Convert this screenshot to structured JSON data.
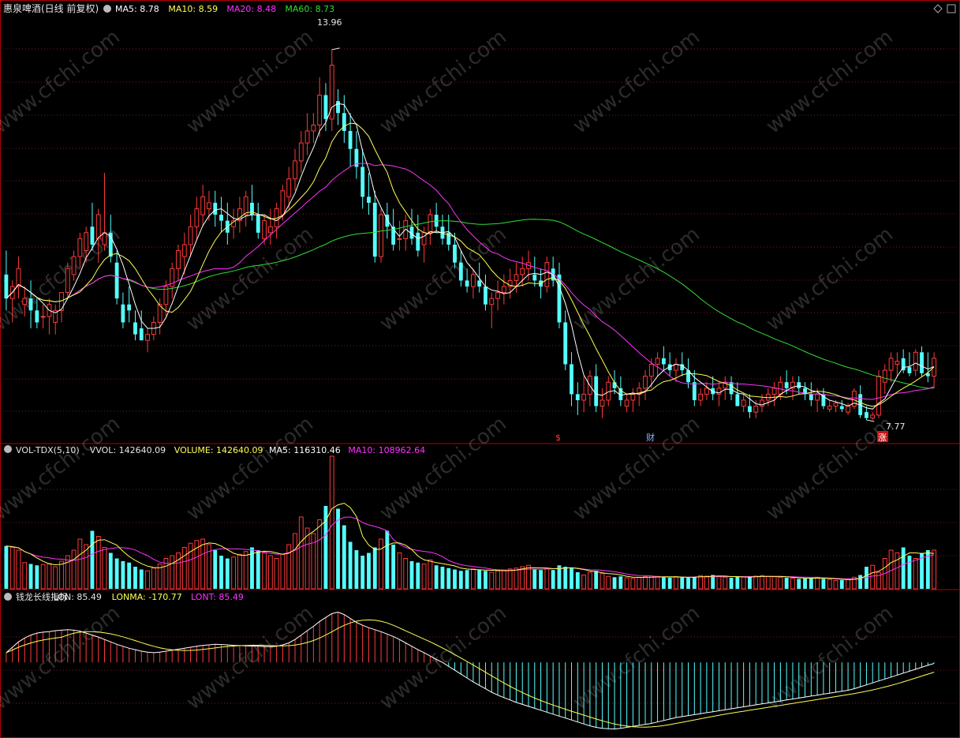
{
  "colors": {
    "background": "#000000",
    "frame": "#b00000",
    "grid": "#7a1a1a",
    "up": "#ff3a3a",
    "down": "#54ffff",
    "text": "#e6e6e6",
    "ma5": "#ffffff",
    "ma10": "#ffff55",
    "ma20": "#ff33ff",
    "ma60": "#33dd33",
    "watermark": "#ffffff"
  },
  "price_panel": {
    "title": "惠泉啤酒(日线 前复权)",
    "legend": [
      {
        "label": "MA5: 8.78",
        "color": "#ffffff"
      },
      {
        "label": "MA10: 8.59",
        "color": "#ffff55"
      },
      {
        "label": "MA20: 8.48",
        "color": "#ff33ff"
      },
      {
        "label": "MA60: 8.73",
        "color": "#33dd33"
      }
    ],
    "high_label": "13.96",
    "low_label": "7.77",
    "event_markers": [
      {
        "text": "$",
        "color": "#ff3a3a"
      },
      {
        "text": "财",
        "color": "#8ab4ff"
      },
      {
        "text": "涨",
        "color": "#ffffff"
      }
    ]
  },
  "volume_panel": {
    "legend": [
      {
        "label": "VOL-TDX(5,10)",
        "color": "#e6e6e6"
      },
      {
        "label": "VVOL: 142640.09",
        "color": "#e6e6e6"
      },
      {
        "label": "VOLUME: 142640.09",
        "color": "#ffff55"
      },
      {
        "label": "MA5: 116310.46",
        "color": "#ffffff"
      },
      {
        "label": "MA10: 108962.64",
        "color": "#ff33ff"
      }
    ]
  },
  "indicator_panel": {
    "legend": [
      {
        "label": "钱龙长线指标",
        "color": "#e6e6e6"
      },
      {
        "label": "LON: 85.49",
        "color": "#e6e6e6"
      },
      {
        "label": "LONMA: -170.77",
        "color": "#ffff55"
      },
      {
        "label": "LONT: 85.49",
        "color": "#ff33ff"
      }
    ]
  },
  "watermark_text": "www.cfchi.com",
  "chart_data": [
    {
      "type": "candlestick",
      "title": "惠泉啤酒(日线 前复权)",
      "series": [
        {
          "name": "MA5",
          "last": 8.78
        },
        {
          "name": "MA10",
          "last": 8.59
        },
        {
          "name": "MA20",
          "last": 8.48
        },
        {
          "name": "MA60",
          "last": 8.73
        }
      ],
      "ylim": [
        7.4,
        14.5
      ],
      "labeled_extremes": {
        "high": 13.96,
        "low": 7.77
      },
      "ohlc": [
        [
          10.2,
          10.6,
          9.6,
          9.8
        ],
        [
          9.8,
          10.1,
          9.4,
          10.0
        ],
        [
          10.0,
          10.5,
          9.8,
          10.3
        ],
        [
          9.7,
          10.0,
          9.5,
          9.8
        ],
        [
          9.8,
          10.1,
          9.3,
          9.6
        ],
        [
          9.6,
          9.8,
          9.3,
          9.4
        ],
        [
          9.5,
          9.7,
          9.3,
          9.5
        ],
        [
          9.5,
          9.8,
          9.2,
          9.7
        ],
        [
          9.4,
          9.7,
          9.2,
          9.6
        ],
        [
          9.6,
          9.9,
          9.4,
          9.9
        ],
        [
          9.9,
          10.4,
          9.8,
          10.3
        ],
        [
          10.2,
          10.6,
          10.1,
          10.5
        ],
        [
          10.5,
          10.9,
          10.3,
          10.8
        ],
        [
          10.6,
          11.0,
          10.4,
          10.9
        ],
        [
          11.0,
          11.4,
          10.6,
          10.7
        ],
        [
          10.8,
          11.3,
          10.4,
          11.2
        ],
        [
          10.7,
          11.9,
          10.6,
          10.9
        ],
        [
          10.9,
          11.2,
          10.4,
          10.5
        ],
        [
          10.4,
          10.6,
          9.7,
          9.8
        ],
        [
          9.7,
          9.9,
          9.3,
          9.4
        ],
        [
          9.7,
          10.0,
          9.4,
          9.6
        ],
        [
          9.4,
          9.6,
          9.1,
          9.2
        ],
        [
          9.3,
          9.6,
          9.1,
          9.1
        ],
        [
          9.1,
          9.3,
          8.9,
          9.2
        ],
        [
          9.2,
          9.5,
          9.1,
          9.4
        ],
        [
          9.4,
          9.8,
          9.2,
          9.7
        ],
        [
          9.7,
          10.1,
          9.5,
          10.0
        ],
        [
          10.0,
          10.4,
          9.8,
          10.3
        ],
        [
          10.3,
          10.7,
          10.1,
          10.6
        ],
        [
          10.5,
          10.9,
          10.2,
          10.7
        ],
        [
          10.7,
          11.2,
          10.5,
          11.0
        ],
        [
          11.0,
          11.5,
          10.8,
          11.3
        ],
        [
          11.2,
          11.7,
          11.0,
          11.5
        ],
        [
          11.3,
          11.6,
          11.1,
          11.4
        ],
        [
          11.4,
          11.6,
          11.0,
          11.2
        ],
        [
          11.2,
          11.5,
          10.9,
          11.1
        ],
        [
          11.1,
          11.4,
          10.7,
          10.9
        ],
        [
          11.0,
          11.3,
          10.8,
          11.1
        ],
        [
          11.1,
          11.5,
          10.9,
          11.3
        ],
        [
          11.2,
          11.6,
          11.0,
          11.5
        ],
        [
          11.4,
          11.7,
          11.1,
          11.2
        ],
        [
          11.2,
          11.4,
          10.8,
          10.9
        ],
        [
          10.8,
          11.2,
          10.7,
          11.1
        ],
        [
          10.9,
          11.3,
          10.7,
          11.0
        ],
        [
          11.0,
          11.4,
          10.8,
          11.3
        ],
        [
          11.2,
          11.7,
          11.1,
          11.6
        ],
        [
          11.5,
          12.0,
          11.3,
          11.8
        ],
        [
          11.8,
          12.3,
          11.6,
          12.1
        ],
        [
          12.1,
          12.6,
          11.9,
          12.4
        ],
        [
          12.4,
          12.9,
          12.2,
          12.6
        ],
        [
          12.6,
          12.9,
          12.4,
          12.7
        ],
        [
          12.7,
          13.5,
          12.5,
          13.2
        ],
        [
          13.2,
          13.4,
          12.6,
          12.8
        ],
        [
          12.8,
          13.96,
          12.6,
          13.7
        ],
        [
          13.1,
          13.3,
          12.7,
          12.9
        ],
        [
          12.9,
          13.2,
          12.4,
          12.6
        ],
        [
          12.6,
          12.9,
          12.0,
          12.3
        ],
        [
          12.3,
          12.6,
          11.8,
          12.0
        ],
        [
          12.0,
          12.3,
          11.3,
          11.5
        ],
        [
          11.5,
          11.9,
          11.2,
          11.4
        ],
        [
          11.4,
          11.6,
          10.4,
          10.5
        ],
        [
          10.5,
          11.3,
          10.4,
          11.2
        ],
        [
          11.2,
          11.4,
          10.8,
          11.0
        ],
        [
          11.0,
          11.3,
          10.6,
          10.7
        ],
        [
          10.8,
          11.1,
          10.6,
          10.8
        ],
        [
          10.8,
          11.2,
          10.6,
          11.1
        ],
        [
          11.0,
          11.3,
          10.7,
          10.8
        ],
        [
          10.9,
          11.2,
          10.5,
          10.6
        ],
        [
          10.7,
          11.0,
          10.4,
          10.9
        ],
        [
          10.9,
          11.3,
          10.7,
          11.2
        ],
        [
          11.2,
          11.4,
          10.9,
          11.0
        ],
        [
          11.0,
          11.2,
          10.7,
          10.8
        ],
        [
          10.9,
          11.2,
          10.6,
          10.7
        ],
        [
          10.7,
          10.9,
          10.3,
          10.4
        ],
        [
          10.4,
          10.6,
          10.0,
          10.1
        ],
        [
          10.1,
          10.3,
          9.9,
          10.0
        ],
        [
          10.0,
          10.3,
          9.8,
          10.2
        ],
        [
          10.1,
          10.4,
          9.9,
          10.0
        ],
        [
          10.0,
          10.2,
          9.6,
          9.7
        ],
        [
          9.7,
          9.9,
          9.3,
          9.8
        ],
        [
          9.8,
          10.1,
          9.6,
          9.9
        ],
        [
          9.9,
          10.2,
          9.7,
          10.0
        ],
        [
          10.0,
          10.3,
          9.8,
          10.1
        ],
        [
          10.1,
          10.4,
          9.9,
          10.2
        ],
        [
          10.2,
          10.5,
          10.0,
          10.3
        ],
        [
          10.3,
          10.6,
          10.1,
          10.4
        ],
        [
          10.2,
          10.5,
          10.0,
          10.1
        ],
        [
          10.1,
          10.3,
          9.8,
          10.0
        ],
        [
          10.0,
          10.5,
          9.9,
          10.4
        ],
        [
          10.3,
          10.5,
          10.0,
          10.1
        ],
        [
          10.2,
          10.4,
          9.3,
          9.4
        ],
        [
          9.4,
          9.6,
          8.6,
          8.7
        ],
        [
          8.7,
          8.9,
          8.0,
          8.2
        ],
        [
          8.2,
          8.4,
          7.85,
          8.1
        ],
        [
          8.1,
          8.5,
          7.9,
          8.2
        ],
        [
          8.2,
          8.6,
          8.0,
          8.5
        ],
        [
          8.5,
          8.7,
          7.9,
          8.0
        ],
        [
          8.0,
          8.3,
          7.8,
          8.1
        ],
        [
          8.1,
          8.5,
          8.0,
          8.4
        ],
        [
          8.4,
          8.6,
          8.2,
          8.3
        ],
        [
          8.3,
          8.5,
          8.0,
          8.1
        ],
        [
          8.0,
          8.2,
          7.9,
          8.1
        ],
        [
          8.1,
          8.3,
          7.9,
          8.2
        ],
        [
          8.2,
          8.4,
          8.0,
          8.3
        ],
        [
          8.3,
          8.6,
          8.1,
          8.5
        ],
        [
          8.5,
          8.8,
          8.3,
          8.7
        ],
        [
          8.7,
          8.9,
          8.5,
          8.8
        ],
        [
          8.8,
          9.0,
          8.6,
          8.7
        ],
        [
          8.7,
          8.9,
          8.5,
          8.6
        ],
        [
          8.6,
          8.8,
          8.4,
          8.7
        ],
        [
          8.7,
          8.9,
          8.5,
          8.6
        ],
        [
          8.6,
          8.8,
          8.3,
          8.4
        ],
        [
          8.4,
          8.6,
          8.0,
          8.1
        ],
        [
          8.1,
          8.3,
          8.0,
          8.2
        ],
        [
          8.2,
          8.4,
          8.1,
          8.3
        ],
        [
          8.3,
          8.5,
          8.1,
          8.2
        ],
        [
          8.2,
          8.4,
          8.0,
          8.3
        ],
        [
          8.3,
          8.5,
          8.1,
          8.4
        ],
        [
          8.4,
          8.5,
          8.1,
          8.2
        ],
        [
          8.2,
          8.4,
          8.0,
          8.0
        ],
        [
          8.0,
          8.2,
          7.9,
          8.1
        ],
        [
          8.0,
          8.2,
          7.8,
          7.9
        ],
        [
          7.9,
          8.1,
          7.8,
          8.0
        ],
        [
          8.0,
          8.2,
          7.9,
          8.1
        ],
        [
          8.1,
          8.3,
          8.0,
          8.2
        ],
        [
          8.2,
          8.4,
          8.0,
          8.3
        ],
        [
          8.2,
          8.5,
          8.1,
          8.4
        ],
        [
          8.4,
          8.6,
          8.2,
          8.3
        ],
        [
          8.3,
          8.5,
          8.1,
          8.4
        ],
        [
          8.4,
          8.5,
          8.2,
          8.3
        ],
        [
          8.3,
          8.4,
          8.1,
          8.2
        ],
        [
          8.2,
          8.4,
          8.0,
          8.1
        ],
        [
          8.1,
          8.3,
          7.9,
          8.2
        ],
        [
          8.2,
          8.3,
          7.95,
          8.0
        ],
        [
          7.95,
          8.1,
          7.9,
          8.0
        ],
        [
          8.0,
          8.1,
          7.9,
          8.05
        ],
        [
          8.0,
          8.1,
          7.9,
          7.95
        ],
        [
          7.9,
          8.05,
          7.85,
          8.0
        ],
        [
          8.0,
          8.3,
          7.95,
          8.25
        ],
        [
          8.2,
          8.35,
          7.8,
          7.85
        ],
        [
          7.9,
          8.0,
          7.77,
          7.8
        ],
        [
          7.8,
          7.9,
          7.77,
          7.85
        ],
        [
          7.85,
          8.6,
          7.8,
          8.5
        ],
        [
          8.4,
          8.7,
          8.2,
          8.6
        ],
        [
          8.6,
          8.9,
          8.4,
          8.8
        ],
        [
          8.7,
          8.9,
          8.5,
          8.75
        ],
        [
          8.8,
          8.95,
          8.55,
          8.6
        ],
        [
          8.65,
          8.9,
          8.5,
          8.55
        ],
        [
          8.6,
          8.95,
          8.5,
          8.9
        ],
        [
          8.9,
          9.0,
          8.5,
          8.55
        ],
        [
          8.55,
          8.9,
          8.4,
          8.5
        ],
        [
          8.5,
          8.9,
          8.3,
          8.8
        ]
      ]
    },
    {
      "type": "bar",
      "title": "VOL-TDX(5,10)",
      "series": [
        {
          "name": "VOLUME",
          "last": 142640.09
        },
        {
          "name": "MA5",
          "last": 116310.46
        },
        {
          "name": "MA10",
          "last": 108962.64
        }
      ],
      "ylim": [
        0,
        480000
      ],
      "values": [
        155000,
        150000,
        140000,
        95000,
        90000,
        85000,
        88000,
        92000,
        80000,
        100000,
        120000,
        140000,
        180000,
        160000,
        210000,
        190000,
        150000,
        130000,
        110000,
        100000,
        95000,
        80000,
        70000,
        65000,
        75000,
        90000,
        110000,
        120000,
        130000,
        150000,
        165000,
        175000,
        180000,
        160000,
        140000,
        120000,
        110000,
        115000,
        125000,
        135000,
        150000,
        140000,
        130000,
        120000,
        110000,
        125000,
        160000,
        200000,
        260000,
        220000,
        200000,
        250000,
        300000,
        480000,
        290000,
        230000,
        170000,
        140000,
        120000,
        130000,
        150000,
        180000,
        210000,
        160000,
        130000,
        110000,
        100000,
        95000,
        90000,
        105000,
        85000,
        80000,
        75000,
        70000,
        65000,
        68000,
        72000,
        70000,
        65000,
        60000,
        65000,
        68000,
        72000,
        75000,
        80000,
        85000,
        70000,
        68000,
        74000,
        68000,
        85000,
        80000,
        75000,
        60000,
        50000,
        60000,
        65000,
        55000,
        45000,
        42000,
        45000,
        40000,
        38000,
        42000,
        44000,
        46000,
        45000,
        42000,
        40000,
        44000,
        42000,
        40000,
        44000,
        48000,
        46000,
        50000,
        44000,
        42000,
        40000,
        45000,
        44000,
        42000,
        46000,
        48000,
        45000,
        44000,
        42000,
        40000,
        38000,
        36000,
        38000,
        40000,
        42000,
        36000,
        34000,
        30000,
        32000,
        34000,
        42000,
        50000,
        80000,
        85000,
        60000,
        110000,
        140000,
        130000,
        150000,
        120000,
        110000,
        130000,
        140000,
        140000
      ]
    },
    {
      "type": "bar",
      "title": "钱龙长线指标",
      "series": [
        {
          "name": "LON",
          "last": 85.49
        },
        {
          "name": "LONMA",
          "last": -170.77
        },
        {
          "name": "LONT",
          "last": 85.49
        }
      ],
      "ylim": [
        -1500,
        1200
      ],
      "values": [
        200,
        310,
        420,
        500,
        560,
        600,
        620,
        630,
        650,
        660,
        670,
        660,
        640,
        600,
        560,
        520,
        470,
        420,
        370,
        330,
        290,
        260,
        230,
        210,
        200,
        210,
        230,
        250,
        270,
        290,
        310,
        330,
        350,
        360,
        370,
        365,
        360,
        350,
        345,
        340,
        335,
        330,
        325,
        320,
        330,
        360,
        400,
        470,
        560,
        650,
        740,
        840,
        920,
        1000,
        1030,
        980,
        900,
        820,
        760,
        710,
        670,
        630,
        580,
        530,
        470,
        400,
        330,
        260,
        200,
        130,
        60,
        0,
        -80,
        -160,
        -240,
        -320,
        -400,
        -470,
        -540,
        -610,
        -670,
        -720,
        -770,
        -820,
        -860,
        -900,
        -940,
        -980,
        -1020,
        -1060,
        -1100,
        -1140,
        -1180,
        -1220,
        -1260,
        -1300,
        -1330,
        -1350,
        -1360,
        -1365,
        -1350,
        -1330,
        -1310,
        -1290,
        -1270,
        -1250,
        -1220,
        -1190,
        -1160,
        -1130,
        -1110,
        -1090,
        -1070,
        -1050,
        -1030,
        -1010,
        -990,
        -970,
        -950,
        -930,
        -910,
        -890,
        -870,
        -850,
        -830,
        -810,
        -790,
        -770,
        -750,
        -730,
        -710,
        -690,
        -670,
        -650,
        -630,
        -610,
        -590,
        -570,
        -540,
        -500,
        -460,
        -420,
        -380,
        -340,
        -300,
        -260,
        -220,
        -180,
        -140,
        -100,
        -60,
        -20
      ]
    }
  ]
}
